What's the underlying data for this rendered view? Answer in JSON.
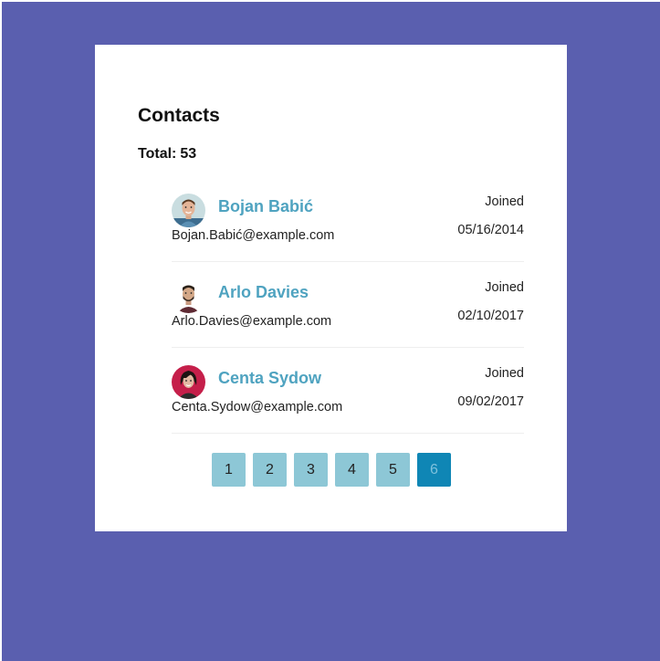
{
  "header": {
    "title": "Contacts",
    "total_label": "Total:",
    "total_value": "53"
  },
  "contacts": [
    {
      "name": "Bojan Babić",
      "email": "Bojan.Babić@example.com",
      "joined_label": "Joined",
      "joined_date": "05/16/2014"
    },
    {
      "name": "Arlo Davies",
      "email": "Arlo.Davies@example.com",
      "joined_label": "Joined",
      "joined_date": "02/10/2017"
    },
    {
      "name": "Centa Sydow",
      "email": "Centa.Sydow@example.com",
      "joined_label": "Joined",
      "joined_date": "09/02/2017"
    }
  ],
  "pagination": {
    "pages": [
      "1",
      "2",
      "3",
      "4",
      "5",
      "6"
    ],
    "active": "6"
  },
  "colors": {
    "background": "#5a5faf",
    "name": "#4fa3c0",
    "page_button": "#8dc7d6",
    "page_button_active": "#0f86b5"
  }
}
